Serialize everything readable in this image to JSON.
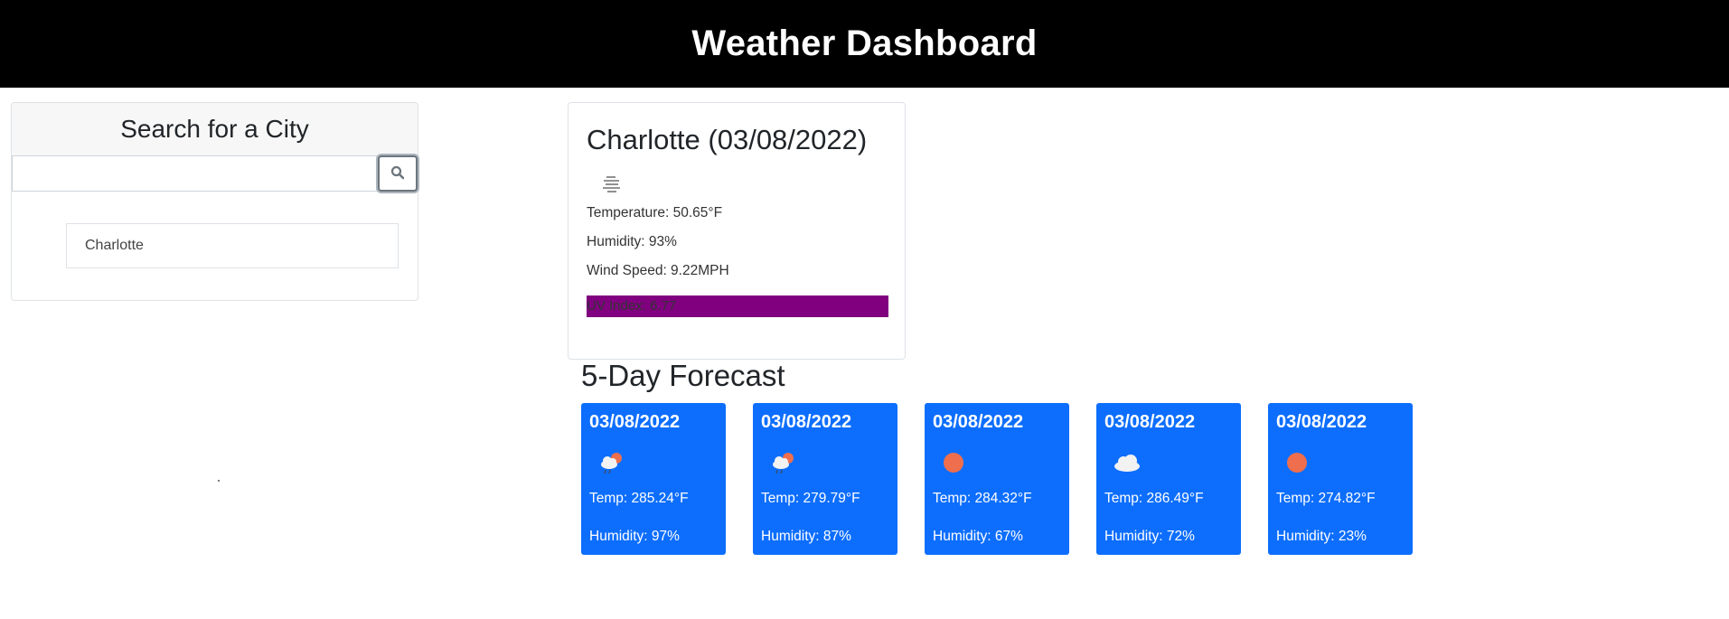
{
  "header": {
    "title": "Weather Dashboard"
  },
  "search": {
    "title": "Search for a City",
    "input_value": "",
    "input_placeholder": "",
    "button_icon": "search-icon",
    "history": [
      "Charlotte"
    ]
  },
  "current": {
    "heading": "Charlotte (03/08/2022)",
    "icon": "mist-icon",
    "temperature": "Temperature: 50.65°F",
    "humidity": "Humidity: 93%",
    "wind": "Wind Speed: 9.22MPH",
    "uv": "UV Index: 6.77",
    "uv_color": "#800080"
  },
  "forecast": {
    "title": "5-Day Forecast",
    "card_color": "#0d6efd",
    "days": [
      {
        "date": "03/08/2022",
        "icon": "rain-sun-icon",
        "temp": "Temp: 285.24°F",
        "humidity": "Humidity: 97%"
      },
      {
        "date": "03/08/2022",
        "icon": "rain-sun-icon",
        "temp": "Temp: 279.79°F",
        "humidity": "Humidity: 87%"
      },
      {
        "date": "03/08/2022",
        "icon": "sun-icon",
        "temp": "Temp: 284.32°F",
        "humidity": "Humidity: 67%"
      },
      {
        "date": "03/08/2022",
        "icon": "cloud-icon",
        "temp": "Temp: 286.49°F",
        "humidity": "Humidity: 72%"
      },
      {
        "date": "03/08/2022",
        "icon": "sun-icon",
        "temp": "Temp: 274.82°F",
        "humidity": "Humidity: 23%"
      }
    ]
  }
}
